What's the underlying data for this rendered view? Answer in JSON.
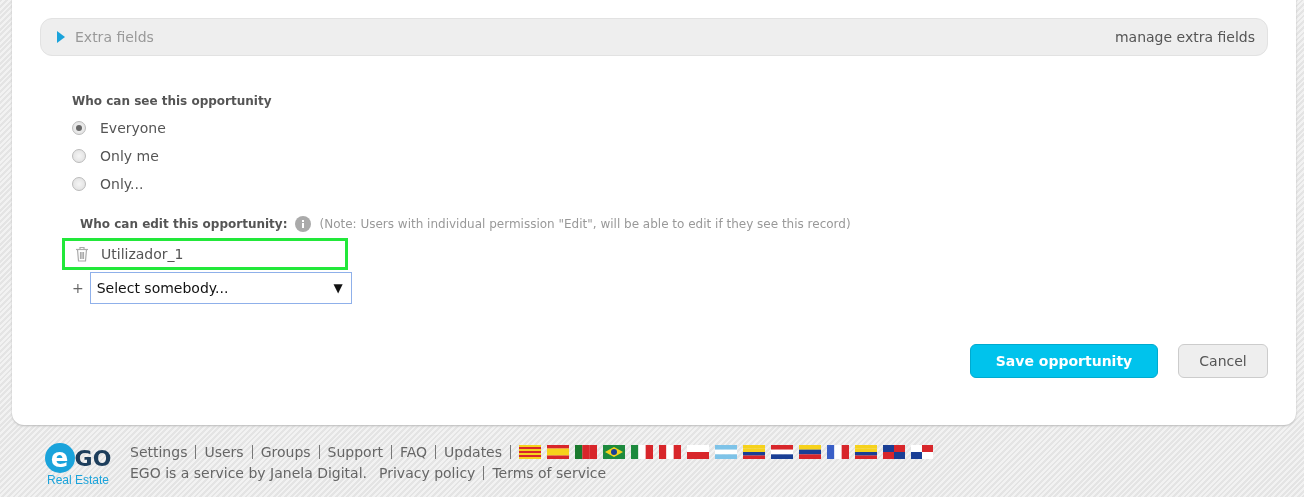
{
  "extra_fields": {
    "label": "Extra fields",
    "expanded": false,
    "link": "manage extra fields"
  },
  "visibility": {
    "title": "Who can see this opportunity",
    "options": [
      {
        "label": "Everyone",
        "selected": true
      },
      {
        "label": "Only me",
        "selected": false
      },
      {
        "label": "Only...",
        "selected": false
      }
    ]
  },
  "editors": {
    "title": "Who can edit this opportunity:",
    "note": "(Note: Users with individual permission \"Edit\", will be able to edit if they see this record)",
    "users": [
      {
        "name": "Utilizador_1",
        "highlighted": true
      }
    ],
    "add": "+",
    "select": {
      "value": "Select somebody...",
      "caret": "▼"
    }
  },
  "buttons": [
    {
      "label": "Save opportunity",
      "kind": "primary"
    },
    {
      "label": "Cancel",
      "kind": "secondary"
    }
  ],
  "footer": {
    "logo": {
      "mark": "e",
      "word": "GO",
      "sub": "Real Estate"
    },
    "links": [
      "Settings",
      "Users",
      "Groups",
      "Support",
      "FAQ",
      "Updates"
    ],
    "service": "EGO is a service by Janela Digital.",
    "legal": [
      "Privacy policy",
      "Terms of service"
    ]
  }
}
